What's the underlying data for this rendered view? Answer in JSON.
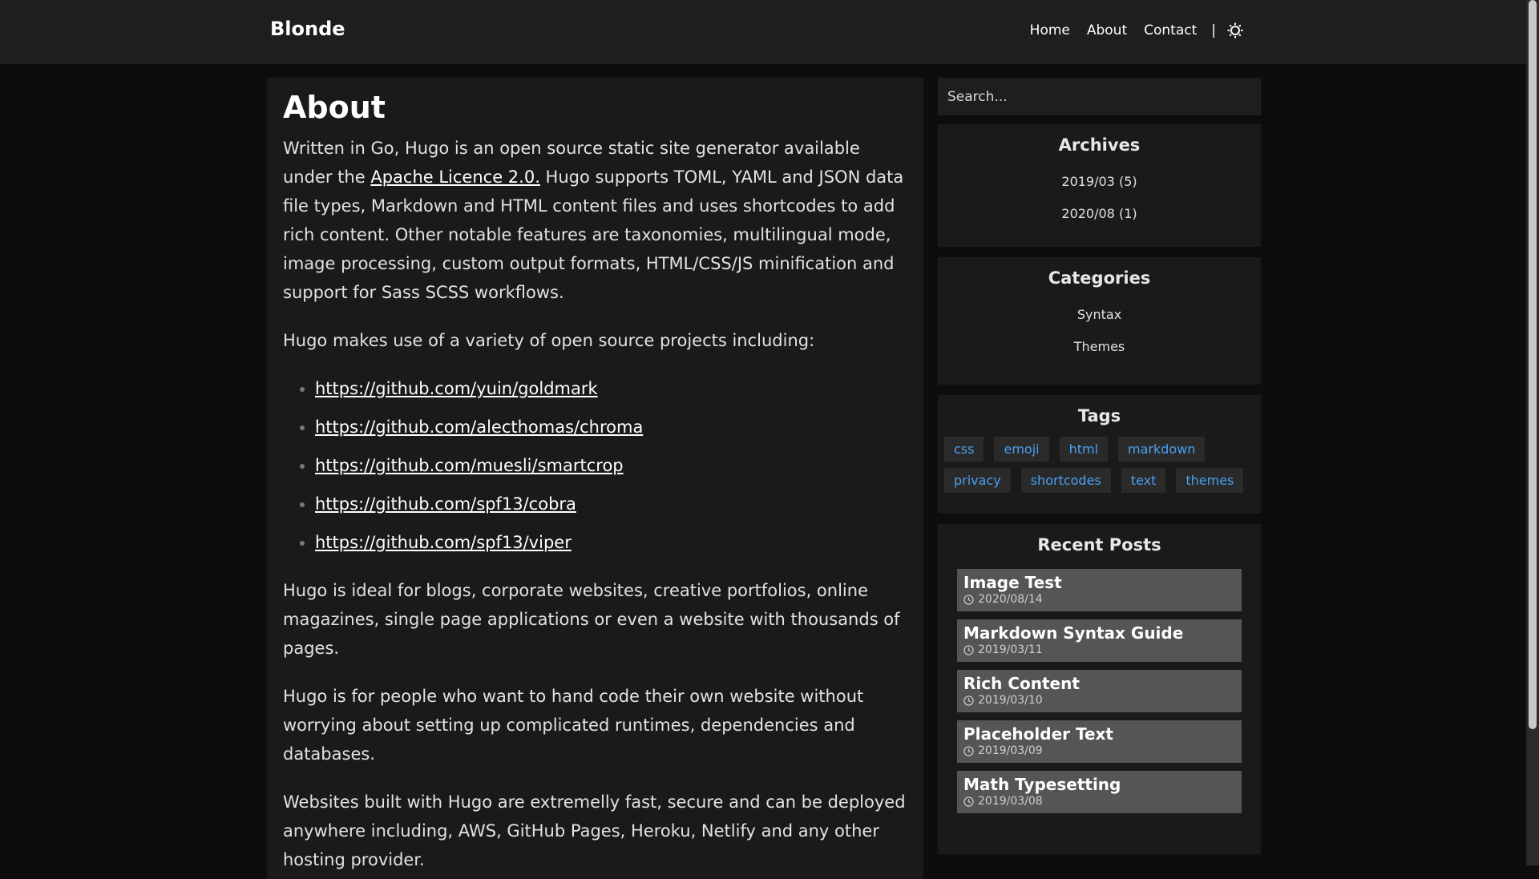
{
  "header": {
    "brand": "Blonde",
    "nav": [
      "Home",
      "About",
      "Contact"
    ],
    "separator": "|",
    "theme_icon": "sun-icon"
  },
  "article": {
    "title": "About",
    "p1_before": "Written in Go, Hugo is an open source static site generator available under the ",
    "p1_link": "Apache Licence 2.0.",
    "p1_after": " Hugo supports TOML, YAML and JSON data file types, Markdown and HTML content files and uses shortcodes to add rich content. Other notable features are taxonomies, multilingual mode, image processing, custom output formats, HTML/CSS/JS minification and support for Sass SCSS workflows.",
    "p2": "Hugo makes use of a variety of open source projects including:",
    "links": [
      "https://github.com/yuin/goldmark",
      "https://github.com/alecthomas/chroma",
      "https://github.com/muesli/smartcrop",
      "https://github.com/spf13/cobra",
      "https://github.com/spf13/viper"
    ],
    "p3": "Hugo is ideal for blogs, corporate websites, creative portfolios, online magazines, single page applications or even a website with thousands of pages.",
    "p4": "Hugo is for people who want to hand code their own website without worrying about setting up complicated runtimes, dependencies and databases.",
    "p5": "Websites built with Hugo are extremelly fast, secure and can be deployed anywhere including, AWS, GitHub Pages, Heroku, Netlify and any other hosting provider."
  },
  "sidebar": {
    "search_placeholder": "Search...",
    "archives": {
      "title": "Archives",
      "items": [
        "2019/03 (5)",
        "2020/08 (1)"
      ]
    },
    "categories": {
      "title": "Categories",
      "items": [
        "Syntax",
        "Themes"
      ]
    },
    "tags": {
      "title": "Tags",
      "items": [
        "css",
        "emoji",
        "html",
        "markdown",
        "privacy",
        "shortcodes",
        "text",
        "themes"
      ]
    },
    "recent": {
      "title": "Recent Posts",
      "posts": [
        {
          "title": "Image Test",
          "date": "2020/08/14"
        },
        {
          "title": "Markdown Syntax Guide",
          "date": "2019/03/11"
        },
        {
          "title": "Rich Content",
          "date": "2019/03/10"
        },
        {
          "title": "Placeholder Text",
          "date": "2019/03/09"
        },
        {
          "title": "Math Typesetting",
          "date": "2019/03/08"
        }
      ]
    }
  },
  "colors": {
    "background": "#0d0d0d",
    "header": "#1e1e1e",
    "panel": "#1a1a1a",
    "tag_text": "#4aa0f0",
    "post_card": "#555555"
  }
}
